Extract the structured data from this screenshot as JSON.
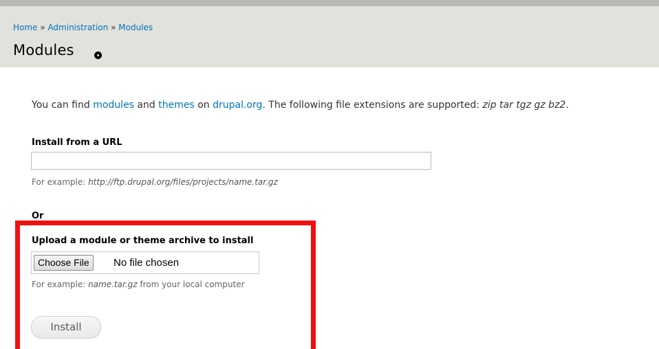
{
  "breadcrumb": {
    "items": [
      "Home",
      "Administration",
      "Modules"
    ],
    "separator": "»"
  },
  "page": {
    "title": "Modules",
    "shortcut_icon": "plus-circle-icon"
  },
  "intro": {
    "text_1": "You can find ",
    "link_modules": "modules",
    "text_2": " and ",
    "link_themes": "themes",
    "text_3": " on ",
    "link_drupal": "drupal.org",
    "text_4": ". The following file extensions are supported: ",
    "extensions": "zip tar tgz gz bz2",
    "text_5": "."
  },
  "install_url": {
    "label": "Install from a URL",
    "value": "",
    "desc_prefix": "For example: ",
    "desc_example": "http://ftp.drupal.org/files/projects/name.tar.gz"
  },
  "or_label": "Or",
  "upload": {
    "label": "Upload a module or theme archive to install",
    "choose_button": "Choose File",
    "file_status": "No file chosen",
    "desc_prefix": "For example: ",
    "desc_example": "name.tar.gz",
    "desc_suffix": " from your local computer"
  },
  "install_button": "Install",
  "colors": {
    "link": "#0074bd",
    "highlight": "#ef1010",
    "header_bg": "#e1e2dc"
  }
}
